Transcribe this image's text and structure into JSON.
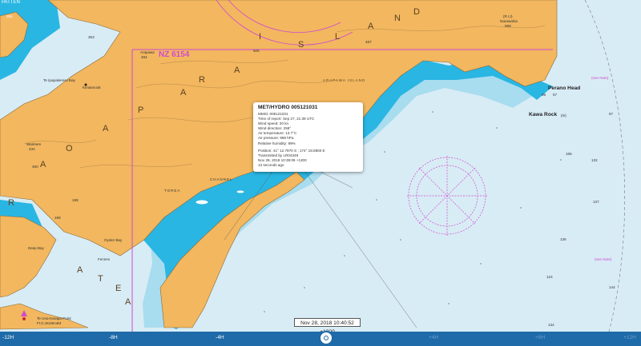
{
  "chart_id": "NZ 6154",
  "labels": {
    "patten": "PATTEN",
    "island_letters": [
      "I",
      "S",
      "L",
      "A",
      "N",
      "D"
    ],
    "arapaoa_letters": [
      "A",
      "R",
      "A",
      "P",
      "A",
      "O",
      "A"
    ],
    "ratea_letters": [
      "R",
      "A",
      "T",
      "E",
      "A"
    ],
    "arapawa_island": "ARAPAWA ISLAND",
    "te_ipapakereru_bay": "Te Ipapakereru Bay",
    "kimiamook": "Kimiamook",
    "arapawa_peak": "Arapawa",
    "waimere": "Waimere",
    "waimere_height": "434",
    "perano_head": "Perano Head",
    "kawa_rock": "Kawa Rock",
    "kawa_rock_depth": "(m)",
    "deep_bay": "Deep Bay",
    "fennes": "Fennes",
    "te_una_karapa_point": "Te Una-Karapa Point",
    "light_char": "Fl.G.3s18m4M",
    "see_note_1": "(see Note)",
    "see_note_2": "(see Note)",
    "torea": "TOREA",
    "channel": "CHANNEL",
    "rk_lt": "(R Lt)",
    "narawahia": "Narawahia",
    "narawahia_height": "558",
    "oyster_bay": "Oyster Bay"
  },
  "heights": [
    "353",
    "484",
    "487",
    "505",
    "198",
    "199",
    "95",
    "57",
    "450",
    "394"
  ],
  "soundings": [
    "165",
    "132",
    "137",
    "124",
    "136",
    "134",
    "144",
    "57"
  ],
  "popup": {
    "title": "MET/HYDRO 005121031",
    "mmsi": "MMSI: 005121031",
    "time_of_report": "Time of report: Sep 27, 21:39 UTC",
    "wind_speed": "Wind speed: 20 kn",
    "wind_direction": "Wind direction: 258°",
    "air_temperature": "Air temperature: 13.7°C",
    "air_pressure": "Air pressure: 998 hPa",
    "relative_humidity": "Relative humidity: 99%",
    "position": "Position: 41° 12.7970 S ; 174° 18.8800 E",
    "transmitted_by": "Transmitted by LR04349",
    "transmitted_time": "Nov 28, 2018 10:39:09 +1300",
    "ago": "13 seconds ago"
  },
  "timeline": {
    "current_time": "Nov 28, 2018 10:40:52 +1300",
    "ticks": [
      "-12H",
      "-8H",
      "-4H",
      "+4H",
      "+8H",
      "+12H"
    ]
  },
  "colors": {
    "land": "#f2b75f",
    "shallow_water": "#29b6e3",
    "mid_water": "#a8dcef",
    "deep_water": "#d8ecf5",
    "chart_magenta": "#d04ad0",
    "timeline_bar": "#1f6aa8"
  }
}
